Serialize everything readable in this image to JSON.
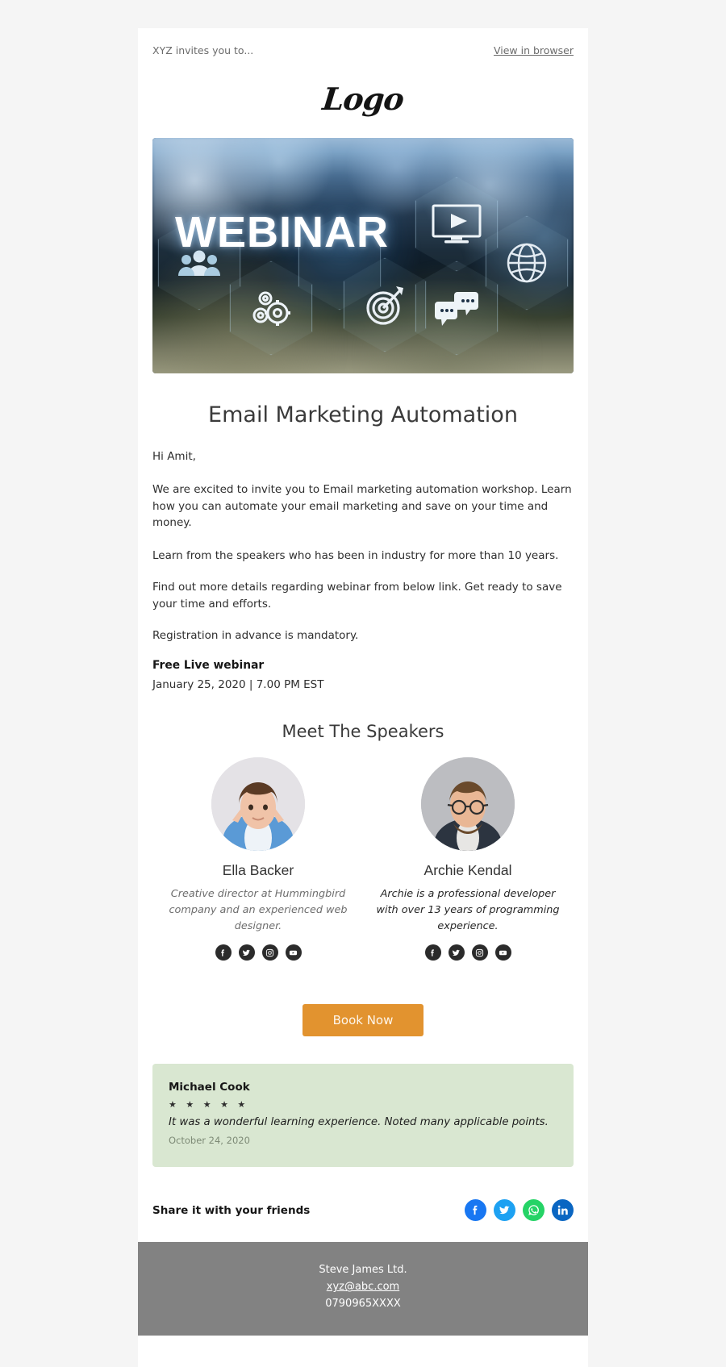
{
  "preheader": {
    "text": "XYZ invites you to...",
    "view_in_browser": "View in browser"
  },
  "logo": {
    "text": "Logo"
  },
  "hero": {
    "title": "WEBINAR",
    "icons": [
      "people-group-icon",
      "gears-icon",
      "target-icon",
      "play-monitor-icon",
      "chat-bubbles-icon",
      "globe-icon"
    ]
  },
  "main": {
    "title": "Email Marketing Automation",
    "greeting": "Hi Amit,",
    "paragraphs": [
      "We are excited to invite you to Email marketing automation workshop. Learn how you can automate your email marketing and save on your time and money.",
      "Learn from the speakers who has been in industry for more than 10 years.",
      "Find out more details regarding webinar from below link. Get ready to save your time and efforts.",
      "Registration in advance is mandatory."
    ],
    "webinar_label": "Free Live webinar",
    "webinar_date": "January 25, 2020 | 7.00 PM EST"
  },
  "speakers_section": {
    "title": "Meet The Speakers",
    "speakers": [
      {
        "name": "Ella Backer",
        "bio": "Creative director at Hummingbird company and an experienced web designer.",
        "socials": [
          "facebook-icon",
          "twitter-icon",
          "instagram-icon",
          "youtube-icon"
        ]
      },
      {
        "name": "Archie Kendal",
        "bio": "Archie is a professional developer with over 13 years of programming experience.",
        "socials": [
          "facebook-icon",
          "twitter-icon",
          "instagram-icon",
          "youtube-icon"
        ]
      }
    ]
  },
  "cta": {
    "label": "Book Now",
    "color": "#e2932f"
  },
  "testimonial": {
    "name": "Michael Cook",
    "stars": "★ ★ ★ ★ ★",
    "rating": 5,
    "quote": "It was a wonderful learning experience. Noted many applicable points.",
    "date": "October 24, 2020",
    "background": "#d9e7d1"
  },
  "share": {
    "label": "Share it with your friends",
    "icons": [
      {
        "name": "facebook-icon",
        "color": "#1877f2"
      },
      {
        "name": "twitter-icon",
        "color": "#1da1f2"
      },
      {
        "name": "whatsapp-icon",
        "color": "#25d366"
      },
      {
        "name": "linkedin-icon",
        "color": "#0a66c2"
      }
    ]
  },
  "footer": {
    "company": "Steve James Ltd.",
    "email": "xyz@abc.com",
    "phone": "0790965XXXX",
    "background": "#828282"
  }
}
